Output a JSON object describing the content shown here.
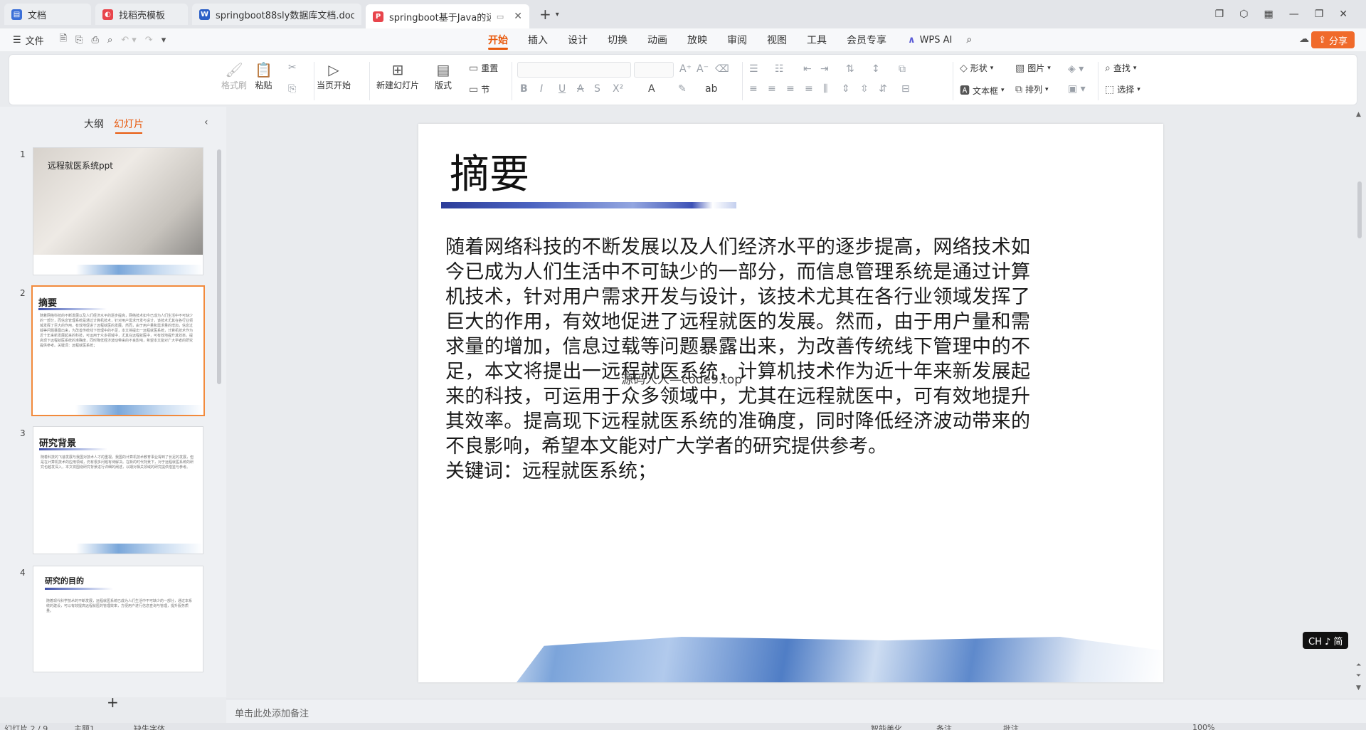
{
  "tabs": [
    {
      "label": "文档",
      "icon": "docs-icon",
      "color": "#3b6fd8",
      "glyph": "W"
    },
    {
      "label": "找稻壳模板",
      "icon": "docer-icon",
      "color": "#e8454c",
      "glyph": "D"
    },
    {
      "label": "springboot88sly数据库文档.doc",
      "icon": "word-icon",
      "color": "#2b5fc7",
      "glyph": "W"
    },
    {
      "label": "springboot基于Java的远程",
      "icon": "ppt-icon",
      "color": "#e8454c",
      "glyph": "P"
    }
  ],
  "menu": {
    "file": "文件",
    "tabs": [
      "开始",
      "插入",
      "设计",
      "切换",
      "动画",
      "放映",
      "审阅",
      "视图",
      "工具",
      "会员专享"
    ],
    "active_tab": "开始",
    "wps_ai": "WPS AI",
    "share": "分享"
  },
  "ribbon": {
    "format_painter": "格式刷",
    "paste": "粘贴",
    "from_current": "当页开始",
    "new_slide": "新建幻灯片",
    "layout": "版式",
    "reset": "重置",
    "section": "节",
    "shape": "形状",
    "picture": "图片",
    "textbox": "文本框",
    "arrange": "排列",
    "find": "查找",
    "select": "选择"
  },
  "panel": {
    "outline_tab": "大纲",
    "slides_tab": "幻灯片"
  },
  "thumbnails": [
    {
      "num": "1",
      "title": "远程就医系统ppt",
      "text": ""
    },
    {
      "num": "2",
      "title": "摘要",
      "text": "随着网络科技的不断发展以及人们经济水平的逐步提高，网络技术如今已成为人们生活中不可缺少的一部分，而信息管理系统是通过计算机技术，针对用户需求开发与设计，该技术尤其在各行业领域发挥了巨大的作用，有效地促进了远程就医的发展。然而，由于用户量和需求量的增加，信息过载等问题暴露出来，为改善传统线下管理中的不足，本文将提出一远程就医系统，计算机技术作为近十年来新发展起来的科技，可运用于众多领域中，尤其在远程就医中，可有效地提升其效率。提高现下远程就医系统的准确度，同时降低经济波动带来的不良影响，希望本文能对广大学者的研究提供参考。关键词：远程就医系统；"
    },
    {
      "num": "3",
      "title": "研究背景",
      "text": "随着科技的飞速发展与我国对技术人才的重视，我国的计算机技术教育事业得到了长足的发展，但是在计算机技术的应用领域，仍有很多问题有待解决。在新的时代背景下，对于远程就医系统的研究也越发深入，本文将围绕研究背景进行详细的阐述，以期对相关领域的研究提供借鉴与参考。"
    },
    {
      "num": "4",
      "title": "研究的目的",
      "text": "随着现代科学技术的不断发展，远程就医系统已成为人们生活中不可缺少的一部分，通过本系统的建设，可以有效提高远程就医的管理效率，方便用户进行信息查询与管理，提升服务质量。"
    }
  ],
  "slide": {
    "title": "摘要",
    "body": "随着网络科技的不断发展以及人们经济水平的逐步提高，网络技术如今已成为人们生活中不可缺少的一部分，而信息管理系统是通过计算机技术，针对用户需求开发与设计，该技术尤其在各行业领域发挥了巨大的作用，有效地促进了远程就医的发展。然而，由于用户量和需求量的增加，信息过载等问题暴露出来，为改善传统线下管理中的不足，本文将提出一远程就医系统，计算机技术作为近十年来新发展起来的科技，可运用于众多领域中，尤其在远程就医中，可有效地提升其效率。提高现下远程就医系统的准确度，同时降低经济波动带来的不良影响，希望本文能对广大学者的研究提供参考。",
    "keywords": "关键词：远程就医系统；",
    "watermark": "源码人人—code9.top"
  },
  "notes_placeholder": "单击此处添加备注",
  "ime": "CH ♪ 简",
  "status": {
    "slide_info": "幻灯片 2 / 9",
    "theme": "主题1",
    "missing_font": "缺失字体",
    "smart_beautify": "智能美化",
    "notes": "备注",
    "comments": "批注",
    "zoom": "100%"
  }
}
